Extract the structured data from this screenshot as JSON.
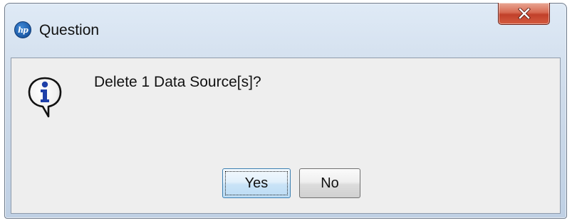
{
  "dialog": {
    "title": "Question",
    "app_logo_text": "hp",
    "app_logo_icon": "hp-logo-icon",
    "close_icon": "close-icon",
    "close_button_color": "#c8442c",
    "message": "Delete 1 Data Source[s]?",
    "message_icon": "info-icon"
  },
  "buttons": {
    "yes_label": "Yes",
    "no_label": "No"
  }
}
